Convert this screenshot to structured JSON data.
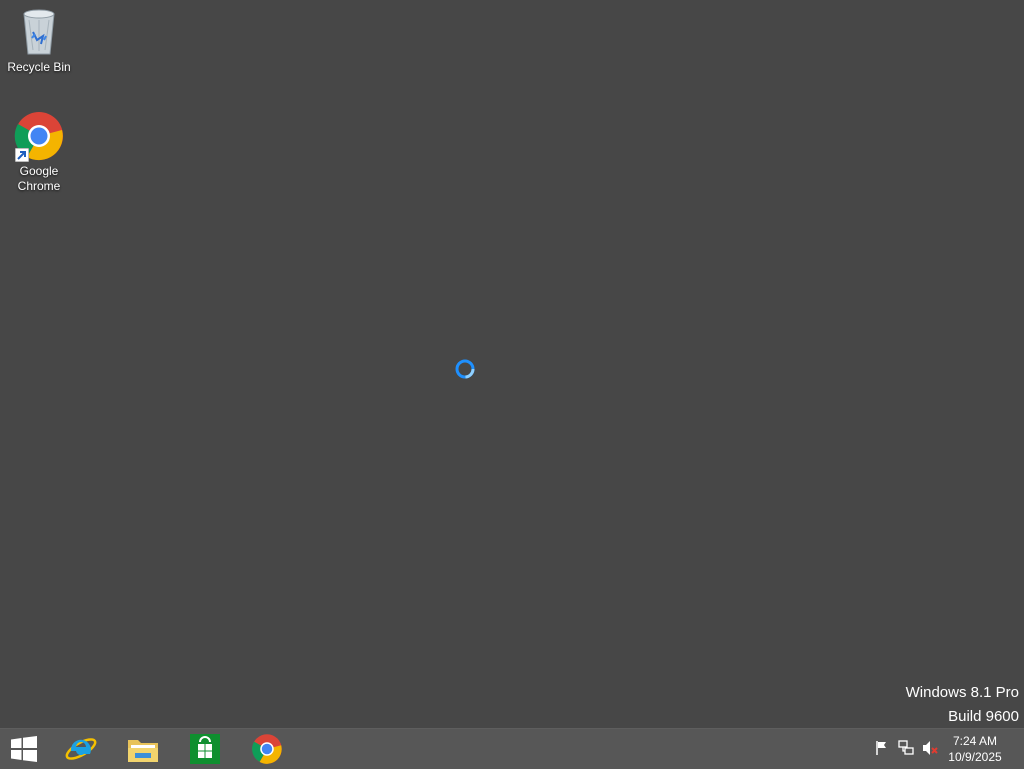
{
  "desktop": {
    "icons": [
      {
        "label": "Recycle Bin",
        "icon": "recycle-bin-icon"
      },
      {
        "label": "Google Chrome",
        "icon": "chrome-icon"
      }
    ],
    "watermark": {
      "line1": "Windows 8.1 Pro",
      "line2": "Build 9600"
    },
    "loading_indicator": "busy-spinner-icon"
  },
  "taskbar": {
    "pinned": [
      {
        "name": "Start",
        "icon": "windows-start-icon"
      },
      {
        "name": "Internet Explorer",
        "icon": "internet-explorer-icon"
      },
      {
        "name": "File Explorer",
        "icon": "file-explorer-icon"
      },
      {
        "name": "Store",
        "icon": "store-icon"
      },
      {
        "name": "Google Chrome",
        "icon": "chrome-icon"
      }
    ],
    "tray": [
      {
        "name": "Action Center",
        "icon": "flag-icon"
      },
      {
        "name": "Network",
        "icon": "network-icon"
      },
      {
        "name": "Volume (muted)",
        "icon": "speaker-muted-icon"
      }
    ],
    "clock": {
      "time": "7:24 AM",
      "date": "10/9/2025"
    }
  },
  "colors": {
    "desktop_background": "#474747",
    "taskbar_background": "#575757",
    "accent": "#1e90ff"
  }
}
